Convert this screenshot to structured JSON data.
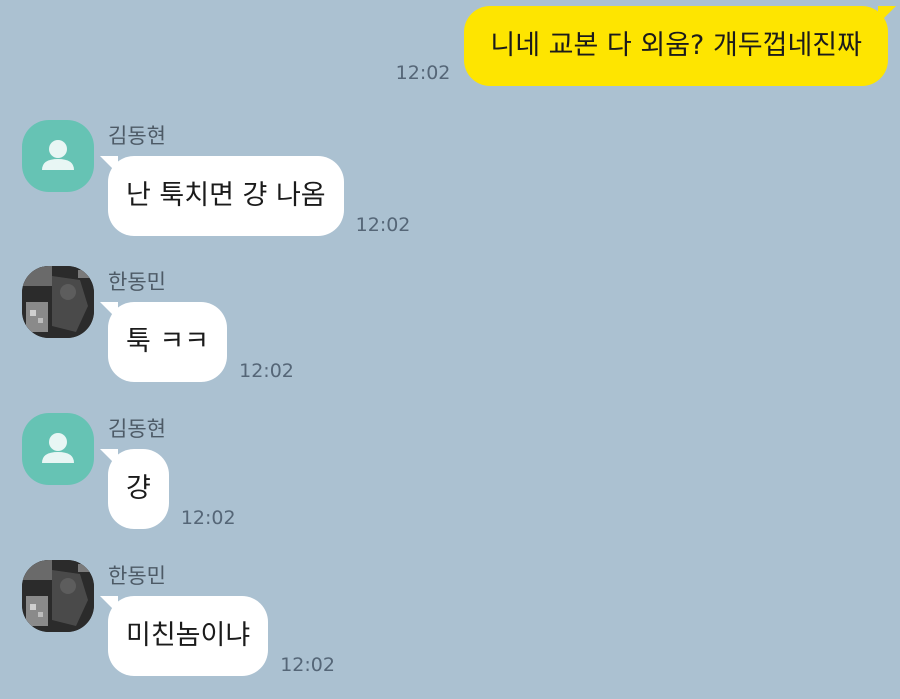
{
  "conversation": {
    "outgoing": {
      "text": "니네 교본 다 외움? 개두껍네진짜",
      "time": "12:02"
    },
    "messages": [
      {
        "sender": "김동현",
        "text": "난 툭치면 걍 나옴",
        "time": "12:02",
        "avatar": "default-profile-icon"
      },
      {
        "sender": "한동민",
        "text": "툭 ㅋㅋ",
        "time": "12:02",
        "avatar": "photo-profile"
      },
      {
        "sender": "김동현",
        "text": "걍",
        "time": "12:02",
        "avatar": "default-profile-icon"
      },
      {
        "sender": "한동민",
        "text": "미친놈이냐",
        "time": "12:02",
        "avatar": "photo-profile"
      }
    ]
  },
  "colors": {
    "background": "#abc1d1",
    "outgoing_bubble": "#fee500",
    "incoming_bubble": "#ffffff",
    "default_avatar": "#66c3b4"
  }
}
